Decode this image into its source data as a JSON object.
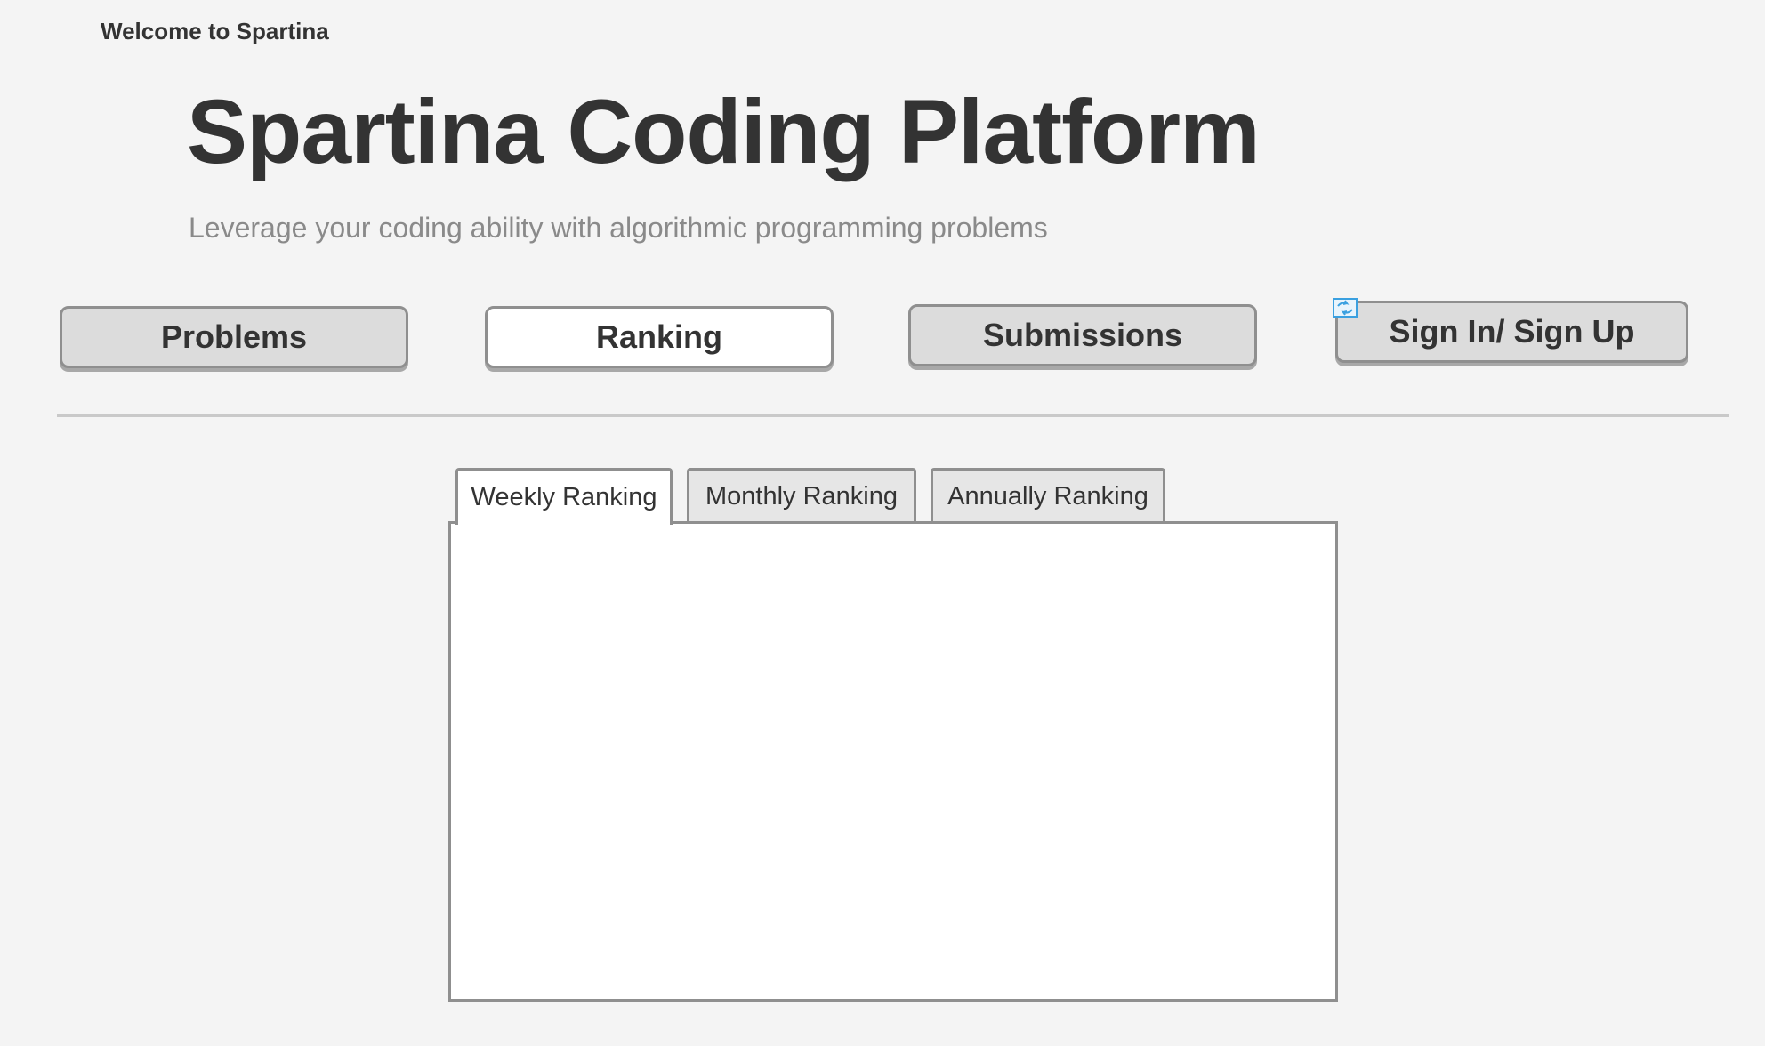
{
  "header": {
    "welcome": "Welcome to Spartina",
    "title": "Spartina Coding Platform",
    "subtitle": "Leverage your coding ability with algorithmic programming problems"
  },
  "nav": {
    "problems": "Problems",
    "ranking": "Ranking",
    "submissions": "Submissions",
    "signin": "Sign In/ Sign Up",
    "active": "Ranking"
  },
  "ranking_tabs": {
    "weekly": "Weekly Ranking",
    "monthly": "Monthly Ranking",
    "annually": "Annually Ranking",
    "active": "Weekly Ranking"
  },
  "colors": {
    "background": "#f4f4f4",
    "text": "#333333",
    "subtitle": "#8a8a8a",
    "button": "#dcdcdc",
    "button_active": "#ffffff",
    "icon_accent": "#3aa0e0"
  },
  "icons": {
    "sign_in_badge": "refresh-icon"
  }
}
